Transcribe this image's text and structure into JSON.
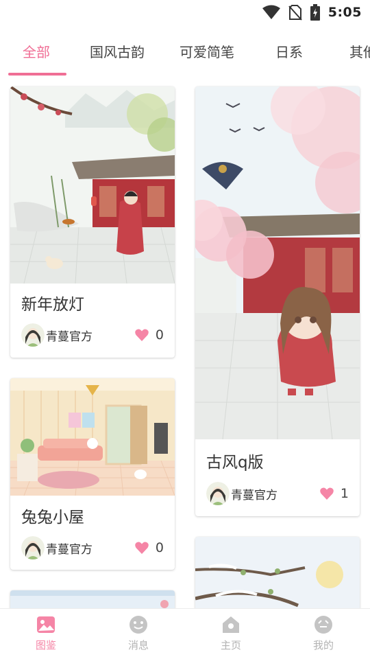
{
  "status_bar": {
    "time": "5:05"
  },
  "tabs": [
    {
      "label": "全部",
      "active": true
    },
    {
      "label": "国风古韵",
      "active": false
    },
    {
      "label": "可爱简笔",
      "active": false
    },
    {
      "label": "日系",
      "active": false
    },
    {
      "label": "其他",
      "active": false
    }
  ],
  "cards": [
    {
      "title": "新年放灯",
      "author": "青蔓官方",
      "likes": "0",
      "image": "chinese courtyard with girl holding lantern stick"
    },
    {
      "title": "古风q版",
      "author": "青蔓官方",
      "likes": "1",
      "image": "chibi girl under cherry blossoms with swallows and kite"
    },
    {
      "title": "兔兔小屋",
      "author": "青蔓官方",
      "likes": "0",
      "image": "pastel living room with bunnies"
    },
    {
      "title": "",
      "author": "",
      "likes": "",
      "image": "sky with blossom branch"
    },
    {
      "title": "",
      "author": "",
      "likes": "",
      "image": "snowy branch with moon"
    }
  ],
  "bottom_nav": [
    {
      "label": "图鉴",
      "icon": "gallery-icon",
      "active": true
    },
    {
      "label": "消息",
      "icon": "message-icon",
      "active": false
    },
    {
      "label": "主页",
      "icon": "home-icon",
      "active": false
    },
    {
      "label": "我的",
      "icon": "profile-icon",
      "active": false
    }
  ],
  "colors": {
    "accent": "#f06e95",
    "heart": "#f585a6",
    "inactive": "#b3b3b3"
  }
}
